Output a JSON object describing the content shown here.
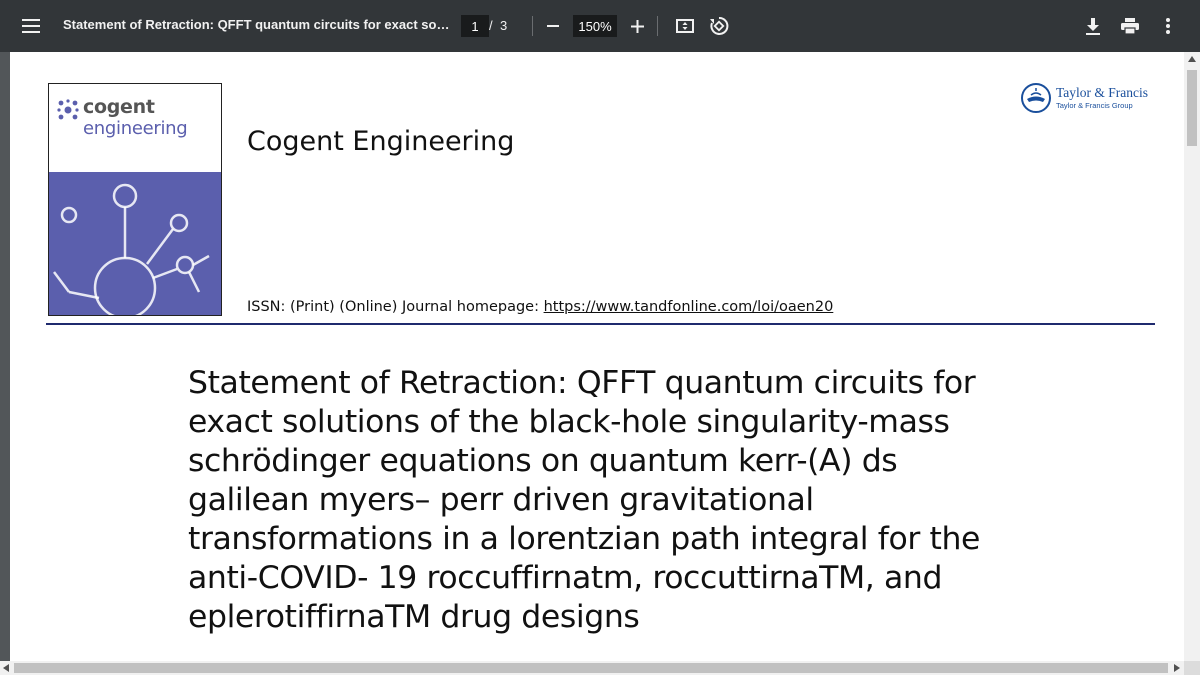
{
  "toolbar": {
    "menu_icon": "hamburger-menu-icon",
    "title": "Statement of Retraction: QFFT quantum circuits for exact soluti...",
    "current_page": "1",
    "page_separator": "/",
    "total_pages": "3",
    "zoom": "150%",
    "zoom_out_icon": "minus-icon",
    "zoom_in_icon": "plus-icon",
    "fit_icon": "fit-to-page-icon",
    "rotate_icon": "rotate-icon",
    "download_icon": "download-icon",
    "print_icon": "print-icon",
    "more_icon": "more-vert-icon",
    "bg_color": "#323639"
  },
  "document": {
    "cover": {
      "logo_line1": "cogent",
      "logo_line2": "engineering",
      "accent_color": "#5b5fad"
    },
    "journal_name": "Cogent Engineering",
    "issn_prefix": "ISSN: (Print) (Online) Journal homepage: ",
    "homepage_url": "https://www.tandfonline.com/loi/oaen20",
    "publisher": {
      "name": "Taylor & Francis",
      "group": "Taylor & Francis Group",
      "color": "#1a4f9c"
    },
    "rule_color": "#1f2a6e",
    "article_title": "Statement of Retraction: QFFT quantum circuits for exact solutions of the black-hole singularity-mass schrödinger equations on quantum kerr-(A) ds galilean myers– perr driven gravitational transformations in a lorentzian path integral for the anti-COVID- 19 roccuffirnatm, roccuttirnaTM, and eplerotiffirnaTM drug designs"
  }
}
